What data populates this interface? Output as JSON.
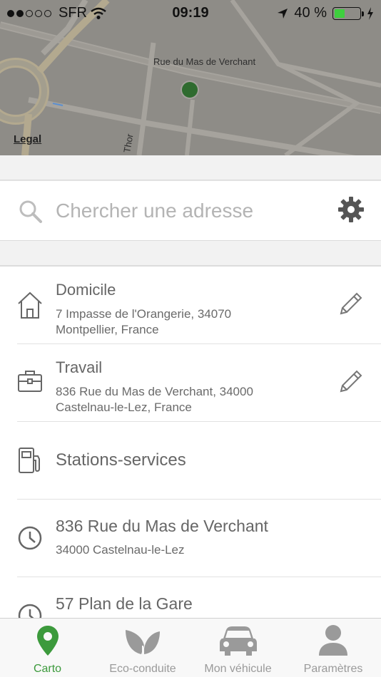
{
  "status_bar": {
    "carrier": "SFR",
    "time": "09:19",
    "battery_percent": "40 %",
    "battery_level": 0.4
  },
  "map": {
    "street_label_1": "Rue du Mas de Verchant",
    "street_label_2": "Thor",
    "legal_label": "Legal"
  },
  "search": {
    "placeholder": "Chercher une adresse"
  },
  "list": {
    "home": {
      "title": "Domicile",
      "address_line1": "7 Impasse de l'Orangerie, 34070",
      "address_line2": "Montpellier, France"
    },
    "work": {
      "title": "Travail",
      "address_line1": "836 Rue du Mas de Verchant, 34000",
      "address_line2": "Castelnau-le-Lez, France"
    },
    "stations": {
      "title": "Stations-services"
    },
    "recent": [
      {
        "title": "836 Rue du Mas de Verchant",
        "subtitle": "34000 Castelnau-le-Lez"
      },
      {
        "title": "57 Plan de la Gare",
        "subtitle": ""
      }
    ]
  },
  "tabs": [
    {
      "label": "Carto",
      "icon": "map-pin-icon",
      "active": true
    },
    {
      "label": "Eco-conduite",
      "icon": "leaf-icon",
      "active": false
    },
    {
      "label": "Mon véhicule",
      "icon": "car-icon",
      "active": false
    },
    {
      "label": "Paramètres",
      "icon": "person-icon",
      "active": false
    }
  ],
  "colors": {
    "accent": "#3c9a3c",
    "map_background": "#8e8c87",
    "location_dot": "#2f6b2f"
  }
}
